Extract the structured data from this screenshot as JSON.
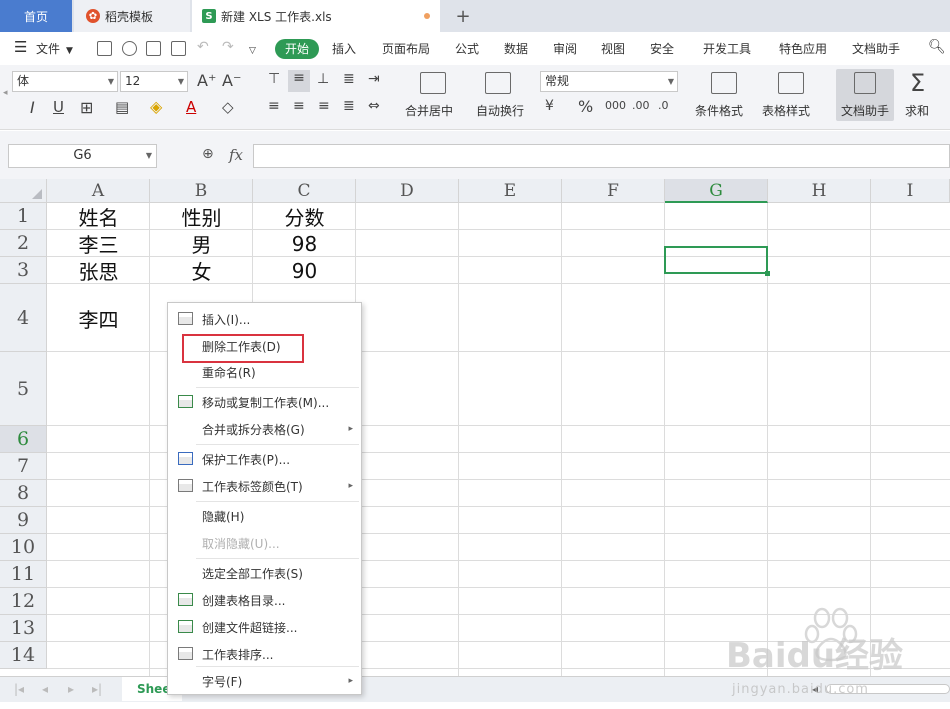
{
  "tabs": [
    {
      "label": "首页"
    },
    {
      "label": "稻壳模板"
    },
    {
      "label": "新建 XLS 工作表.xls"
    }
  ],
  "menubar": {
    "file": "文件",
    "items": [
      "开始",
      "插入",
      "页面布局",
      "公式",
      "数据",
      "审阅",
      "视图",
      "安全",
      "开发工具",
      "特色应用",
      "文档助手"
    ]
  },
  "ribbon": {
    "font_name": "体",
    "font_size": "12",
    "number_format": "常规",
    "merge_center": "合并居中",
    "wrap_text": "自动换行",
    "cond_format": "条件格式",
    "table_style": "表格样式",
    "doc_helper": "文档助手",
    "sum": "求和"
  },
  "formula": {
    "name_box": "G6",
    "fx_label": "fx",
    "content": ""
  },
  "grid": {
    "columns": [
      "A",
      "B",
      "C",
      "D",
      "E",
      "F",
      "G",
      "H",
      "I"
    ],
    "rows": [
      "1",
      "2",
      "3",
      "4",
      "5",
      "6",
      "7",
      "8",
      "9",
      "10",
      "11",
      "12",
      "13",
      "14"
    ],
    "cells": [
      {
        "ref": "A1",
        "value": "姓名"
      },
      {
        "ref": "B1",
        "value": "性别"
      },
      {
        "ref": "C1",
        "value": "分数"
      },
      {
        "ref": "A2",
        "value": "李三"
      },
      {
        "ref": "B2",
        "value": "男"
      },
      {
        "ref": "C2",
        "value": "98"
      },
      {
        "ref": "A3",
        "value": "张思"
      },
      {
        "ref": "B3",
        "value": "女"
      },
      {
        "ref": "C3",
        "value": "90"
      },
      {
        "ref": "A4",
        "value": "李四"
      }
    ],
    "selected": "G6"
  },
  "context_menu": {
    "items": [
      {
        "label": "插入(I)..."
      },
      {
        "label": "删除工作表(D)"
      },
      {
        "label": "重命名(R)"
      },
      {
        "label": "移动或复制工作表(M)..."
      },
      {
        "label": "合并或拆分表格(G)"
      },
      {
        "label": "保护工作表(P)..."
      },
      {
        "label": "工作表标签颜色(T)"
      },
      {
        "label": "隐藏(H)"
      },
      {
        "label": "取消隐藏(U)..."
      },
      {
        "label": "选定全部工作表(S)"
      },
      {
        "label": "创建表格目录..."
      },
      {
        "label": "创建文件超链接..."
      },
      {
        "label": "工作表排序..."
      },
      {
        "label": "字号(F)"
      }
    ]
  },
  "sheetbar": {
    "sheet_name": "Sheet"
  },
  "watermark": {
    "brand": "Baidu经验",
    "url": "jingyan.baidu.com"
  },
  "colors": {
    "accent": "#2e9a55",
    "tab_blue": "#4a7ccf",
    "highlight_red": "#d9333f"
  }
}
